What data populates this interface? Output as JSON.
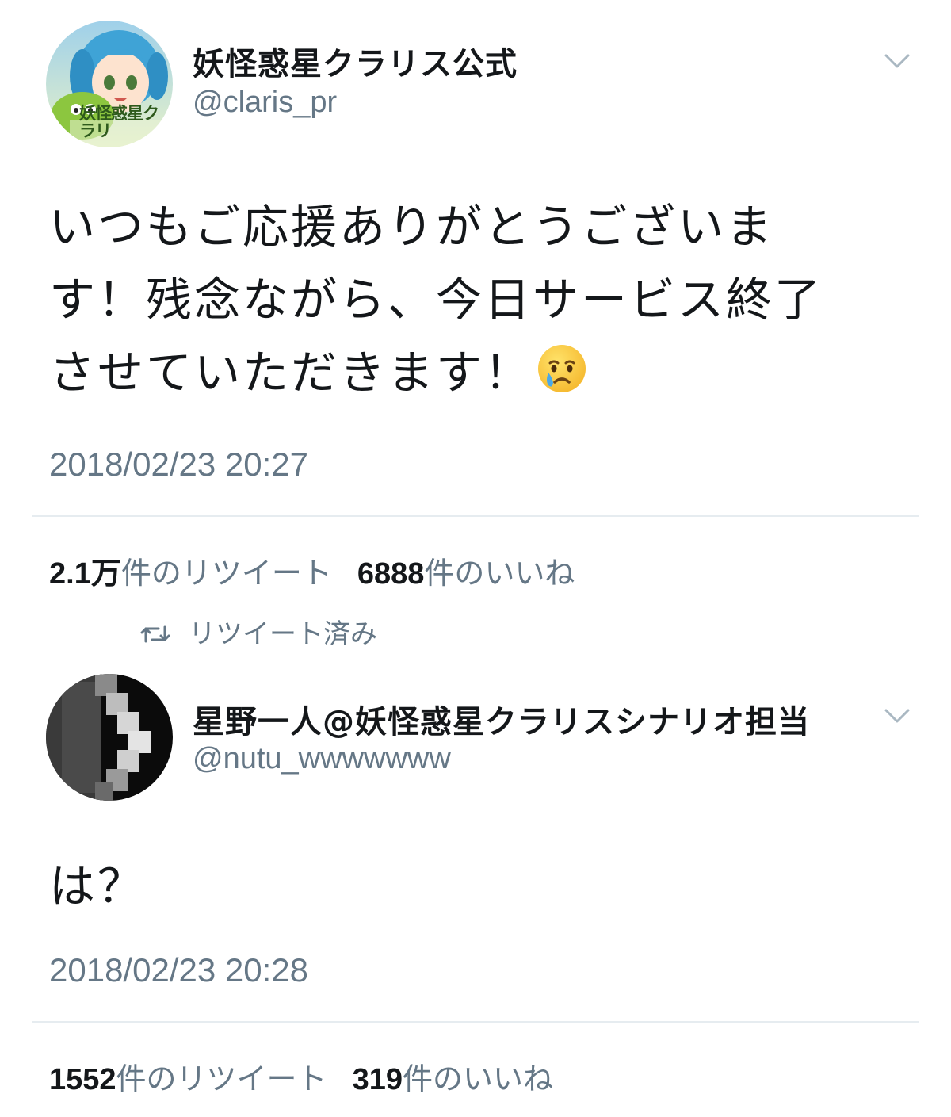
{
  "tweets": [
    {
      "display_name": "妖怪惑星クラリス公式",
      "handle": "@claris_pr",
      "avatar_text": "妖怪惑星クラリ",
      "text_lines": [
        "いつもご応援ありがとうございま",
        "す！残念ながら、今日サービス終了",
        "させていただきます！"
      ],
      "emoji": "crying-face-emoji",
      "timestamp": "2018/02/23 20:27",
      "retweet_count": "2.1万",
      "retweet_label": "件のリツイート",
      "like_count": "6888",
      "like_label": "件のいいね"
    },
    {
      "display_name": "星野一人@妖怪惑星クラリスシナリオ担当",
      "handle": "@nutu_wwwwwww",
      "text": "は？",
      "timestamp": "2018/02/23 20:28",
      "retweet_count": "1552",
      "retweet_label": "件のリツイート",
      "like_count": "319",
      "like_label": "件のいいね"
    }
  ],
  "retweeted_label": "リツイート済み"
}
